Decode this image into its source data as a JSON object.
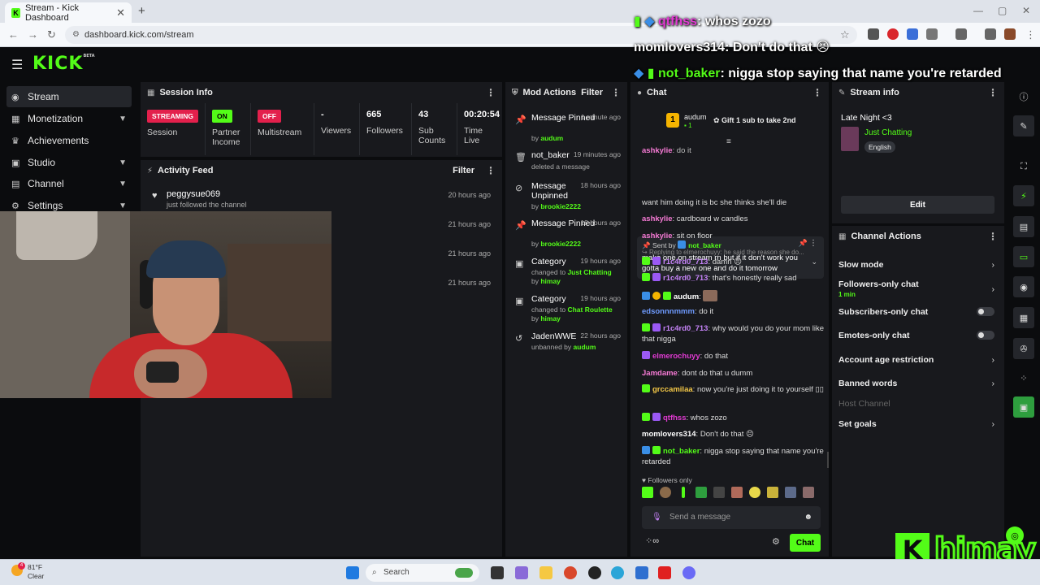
{
  "browser": {
    "tab_title": "Stream - Kick Dashboard",
    "url": "dashboard.kick.com/stream",
    "new_tab": "+",
    "close_tab": "✕"
  },
  "kick": {
    "logo": "KICK",
    "beta": "BETA"
  },
  "sidebar": {
    "items": [
      {
        "label": "Stream",
        "icon": "stream-icon"
      },
      {
        "label": "Monetization",
        "icon": "money-icon"
      },
      {
        "label": "Achievements",
        "icon": "trophy-icon"
      },
      {
        "label": "Studio",
        "icon": "studio-icon"
      },
      {
        "label": "Channel",
        "icon": "channel-icon"
      },
      {
        "label": "Settings",
        "icon": "gear-icon"
      }
    ]
  },
  "session_info": {
    "title": "Session Info",
    "cells": [
      {
        "badge": "STREAMING",
        "label": "Session"
      },
      {
        "badge": "ON",
        "label": "Partner Income"
      },
      {
        "badge": "OFF",
        "label": "Multistream"
      },
      {
        "value": "-",
        "label": "Viewers"
      },
      {
        "value": "665",
        "label": "Followers"
      },
      {
        "value": "43",
        "label": "Sub Counts"
      },
      {
        "value": "00:20:54",
        "label": "Time Live"
      }
    ]
  },
  "activity_feed": {
    "title": "Activity Feed",
    "filter": "Filter",
    "items": [
      {
        "name": "peggysue069",
        "sub": "just followed the channel",
        "time": "20 hours ago"
      },
      {
        "time": "21 hours ago"
      },
      {
        "time": "21 hours ago"
      },
      {
        "time": "21 hours ago"
      }
    ]
  },
  "mod_actions": {
    "title": "Mod Actions",
    "filter": "Filter",
    "items": [
      {
        "title": "Message Pinned",
        "time": "1 minute ago",
        "sub": "by ",
        "user": "audum"
      },
      {
        "title": "not_baker",
        "time": "19 minutes ago",
        "sub": "deleted a message",
        "user": ""
      },
      {
        "title": "Message Unpinned",
        "time": "18 hours ago",
        "sub": "by ",
        "user": "brookie2222"
      },
      {
        "title": "Message Pinned",
        "time": "18 hours ago",
        "sub": "by ",
        "user": "brookie2222"
      },
      {
        "title": "Category",
        "time": "19 hours ago",
        "sub": "changed to ",
        "user": "Just Chatting",
        "sub2": "by ",
        "user2": "himay"
      },
      {
        "title": "Category",
        "time": "19 hours ago",
        "sub": "changed to ",
        "user": "Chat Roulette",
        "sub2": "by ",
        "user2": "himay"
      },
      {
        "title": "JadenWWE",
        "time": "22 hours ago",
        "sub": "unbanned by ",
        "user": "audum"
      }
    ]
  },
  "chat": {
    "title": "Chat",
    "gift_user": "audum",
    "gift_count": "1",
    "gift_text": "Gift 1 sub to take 2nd",
    "pinned_by_prefix": "Sent by",
    "pinned_user": "not_baker",
    "pinned_text": "make one on stream rn but if it don't work you gotta buy a new one and do it tomorrow",
    "messages": [
      {
        "user": "ashkylie",
        "color": "#f57ad4",
        "text": "do it"
      },
      {
        "user": "",
        "color": "#ddd",
        "text": "want him doing it is bc she thinks she'll die"
      },
      {
        "user": "ashkylie",
        "color": "#f57ad4",
        "text": "cardboard w candles"
      },
      {
        "user": "ashkylie",
        "color": "#f57ad4",
        "text": "sit on floor"
      },
      {
        "reply": "Replying to elmerochuyy: he said the reason she do..."
      },
      {
        "user": "r1c4rd0_713",
        "color": "#c583f7",
        "text": "damn 😣"
      },
      {
        "user": "r1c4rd0_713",
        "color": "#c583f7",
        "text": "that's honestly really sad"
      },
      {
        "user": "audum",
        "color": "#ffffff",
        "text": ""
      },
      {
        "user": "edsonnnmmm",
        "color": "#6f9bff",
        "text": "do it"
      },
      {
        "user": "r1c4rd0_713",
        "color": "#c583f7",
        "text": "why would you do your mom like that nigga"
      },
      {
        "user": "elmerochuyy",
        "color": "#e23ad3",
        "text": "do that"
      },
      {
        "user": "Jamdame",
        "color": "#f57ad4",
        "text": "dont do that u dumm"
      },
      {
        "user": "grccamilaa",
        "color": "#f5c947",
        "text": "now you're just doing it to yourself ▯▯"
      },
      {
        "user": "qtfhss",
        "color": "#e23ad3",
        "text": "whos zozo"
      },
      {
        "user": "momlovers314",
        "color": "#ffffff",
        "text": "Don't do that 😣"
      },
      {
        "user": "not_baker",
        "color": "#53fc18",
        "text": "nigga stop saying that name you're retarded"
      }
    ],
    "followers_only": "Followers only",
    "placeholder": "Send a message",
    "send": "Chat"
  },
  "stream_info": {
    "title": "Stream info",
    "stream_title": "Late Night <3",
    "category": "Just Chatting",
    "language": "English",
    "edit": "Edit"
  },
  "channel_actions": {
    "title": "Channel Actions",
    "items": [
      {
        "label": "Slow mode",
        "control": "arrow"
      },
      {
        "label": "Followers-only chat",
        "sub": "1 min",
        "control": "arrow"
      },
      {
        "label": "Subscribers-only chat",
        "control": "toggle"
      },
      {
        "label": "Emotes-only chat",
        "control": "toggle"
      },
      {
        "label": "Account age restriction",
        "control": "arrow"
      },
      {
        "label": "Banned words",
        "control": "arrow"
      },
      {
        "label": "Host Channel",
        "control": "none",
        "disabled": true
      },
      {
        "label": "Set goals",
        "control": "arrow"
      }
    ]
  },
  "overlay_chat": [
    {
      "user": "qtfhss",
      "color": "#e23ad3",
      "text": "whos zozo"
    },
    {
      "user": "momlovers314",
      "color": "#ffffff",
      "text": "Don't do that 😣"
    },
    {
      "user": "not_baker",
      "color": "#53fc18",
      "text": "nigga stop saying that name you're retarded"
    }
  ],
  "taskbar": {
    "temp": "81°F",
    "weather": "Clear",
    "search": "Search",
    "notif_count": "4"
  },
  "watermark": "himay",
  "colors": {
    "kick_green": "#53fc18",
    "streaming_red": "#e3204c",
    "panel_bg": "#18191d"
  }
}
